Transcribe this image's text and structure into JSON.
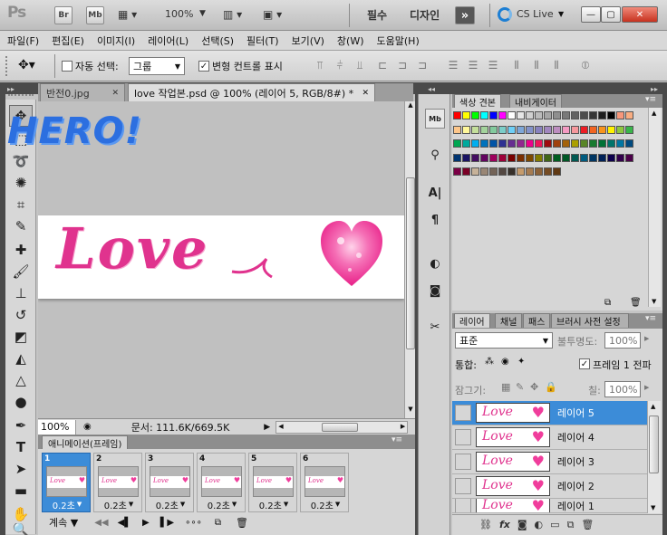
{
  "titlebar": {
    "logo": "Ps",
    "bridge_btn": "Br",
    "minibridge_btn": "Mb",
    "zoom": "100%",
    "workspace_1": "필수",
    "workspace_2": "디자인",
    "expand": "»",
    "cslive": "CS Live"
  },
  "menu": [
    "파일(F)",
    "편집(E)",
    "이미지(I)",
    "레이어(L)",
    "선택(S)",
    "필터(T)",
    "보기(V)",
    "창(W)",
    "도움말(H)"
  ],
  "options": {
    "auto_select_label": "자동 선택:",
    "auto_select_value": "그룹",
    "transform_label": "변형 컨트롤 표시"
  },
  "tabs": [
    {
      "label": "반전0.jpg"
    },
    {
      "label": "love 작업본.psd @ 100% (레이어 5, RGB/8#) *"
    }
  ],
  "canvas": {
    "hero_text": "HERO!",
    "love_text": "Love",
    "colors": {
      "hero": "#2c6fe0",
      "love": "#e0338e",
      "heart": "#f03d9c"
    }
  },
  "status": {
    "zoom": "100%",
    "doc": "문서: 111.6K/669.5K"
  },
  "animation": {
    "title": "애니메이션(프레임)",
    "frames": [
      {
        "num": "1",
        "time": "0.2초"
      },
      {
        "num": "2",
        "time": "0.2초"
      },
      {
        "num": "3",
        "time": "0.2초"
      },
      {
        "num": "4",
        "time": "0.2초"
      },
      {
        "num": "5",
        "time": "0.2초"
      },
      {
        "num": "6",
        "time": "0.2초"
      }
    ],
    "loop": "계속"
  },
  "swatches_panel": {
    "tab_1": "색상 견본",
    "tab_2": "내비게이터"
  },
  "layers_panel": {
    "tabs": [
      "레이어",
      "채널",
      "패스",
      "브러시 사전 설정"
    ],
    "blend_mode": "표준",
    "opacity_label": "불투명도:",
    "opacity_value": "100%",
    "unify_label": "통합:",
    "propagate_label": "프레임 1 전파",
    "lock_label": "잠그기:",
    "fill_label": "칠:",
    "fill_value": "100%",
    "layers": [
      {
        "name": "레이어 5",
        "active": true
      },
      {
        "name": "레이어 4",
        "active": false
      },
      {
        "name": "레이어 3",
        "active": false
      },
      {
        "name": "레이어 2",
        "active": false
      },
      {
        "name": "레이어 1",
        "active": false
      }
    ]
  }
}
